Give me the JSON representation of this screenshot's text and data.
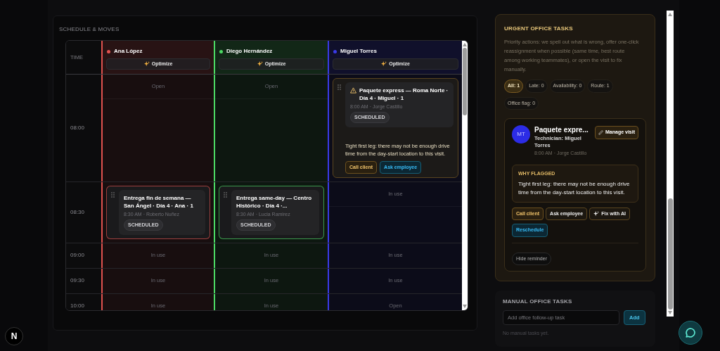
{
  "schedule": {
    "title": "SCHEDULE & MOVES",
    "time_header": "TIME",
    "technicians": [
      {
        "name": "Ana López",
        "color": "#e0524f",
        "optimize": "Optimize"
      },
      {
        "name": "Diego Hernández",
        "color": "#4cd964",
        "optimize": "Optimize"
      },
      {
        "name": "Miguel Torres",
        "color": "#3a3ae8",
        "optimize": "Optimize"
      }
    ],
    "rows": [
      {
        "time": "08:00",
        "cells": [
          {
            "kind": "slot",
            "label": "Open",
            "split": true
          },
          {
            "kind": "slot",
            "label": "Open",
            "split": true
          },
          {
            "kind": "visit",
            "flagged": true,
            "title": "Paquete express — Roma Norte · Día 4 · Miguel · 1",
            "meta": "8:00 AM · Jorge Castillo",
            "status": "SCHEDULED",
            "note": "Tight first leg: there may not be enough drive time from the day-start location to this visit.",
            "actions": [
              {
                "label": "Call client",
                "kind": "amber"
              },
              {
                "label": "Ask employee",
                "kind": "cyan"
              }
            ]
          }
        ]
      },
      {
        "time": "08:30",
        "cells": [
          {
            "kind": "visit",
            "flagged": false,
            "title": "Entrega fin de semana — San Ángel · Día 4 · Ana · 1",
            "meta": "8:30 AM · Roberto Nuñez",
            "status": "SCHEDULED"
          },
          {
            "kind": "visit",
            "flagged": false,
            "title": "Entrega same-day — Centro Histórico · Día 4 ·...",
            "meta": "8:30 AM · Lucia Ramirez",
            "status": "SCHEDULED"
          },
          {
            "kind": "slot",
            "label": "In use",
            "split": true
          }
        ]
      },
      {
        "time": "09:00",
        "cells": [
          {
            "kind": "slot",
            "label": "In use",
            "split": false
          },
          {
            "kind": "slot",
            "label": "In use",
            "split": false
          },
          {
            "kind": "slot",
            "label": "In use",
            "split": false
          }
        ]
      },
      {
        "time": "09:30",
        "cells": [
          {
            "kind": "slot",
            "label": "In use",
            "split": false
          },
          {
            "kind": "slot",
            "label": "In use",
            "split": false
          },
          {
            "kind": "slot",
            "label": "In use",
            "split": false
          }
        ]
      },
      {
        "time": "10:00",
        "cells": [
          {
            "kind": "slot",
            "label": "In use",
            "split": false
          },
          {
            "kind": "slot",
            "label": "In use",
            "split": false
          },
          {
            "kind": "slot",
            "label": "Open",
            "split": false
          }
        ]
      }
    ]
  },
  "urgent": {
    "title": "URGENT OFFICE TASKS",
    "description": "Priority actions: we spell out what is wrong, offer one-click reassignment when possible (same time, best route among working teammates), or open the visit to fix manually.",
    "filters": [
      {
        "label": "All: 1",
        "selected": true
      },
      {
        "label": "Late: 0",
        "selected": false
      },
      {
        "label": "Availability: 0",
        "selected": false
      },
      {
        "label": "Route: 1",
        "selected": false
      },
      {
        "label": "Office flag: 0",
        "selected": false
      }
    ],
    "task": {
      "initials": "MT",
      "title": "Paquete expre...",
      "technician": "Technician: Miguel Torres",
      "meta": "8:00 AM · Jorge Castillo",
      "manage": "Manage visit",
      "why_title": "WHY FLAGGED",
      "reason": "Tight first leg: there may not be enough drive time from the day-start location to this visit.",
      "actions": [
        {
          "label": "Call client",
          "kind": "amber",
          "icon": false
        },
        {
          "label": "Ask employee",
          "kind": "plain",
          "icon": false
        },
        {
          "label": "Fix with AI",
          "kind": "plain",
          "icon": true
        },
        {
          "label": "Reschedule",
          "kind": "cyan",
          "icon": false
        }
      ],
      "hide": "Hide reminder"
    }
  },
  "manual": {
    "title": "MANUAL OFFICE TASKS",
    "placeholder": "Add office follow-up task",
    "add": "Add",
    "empty": "No manual tasks yet."
  },
  "logo": "N"
}
